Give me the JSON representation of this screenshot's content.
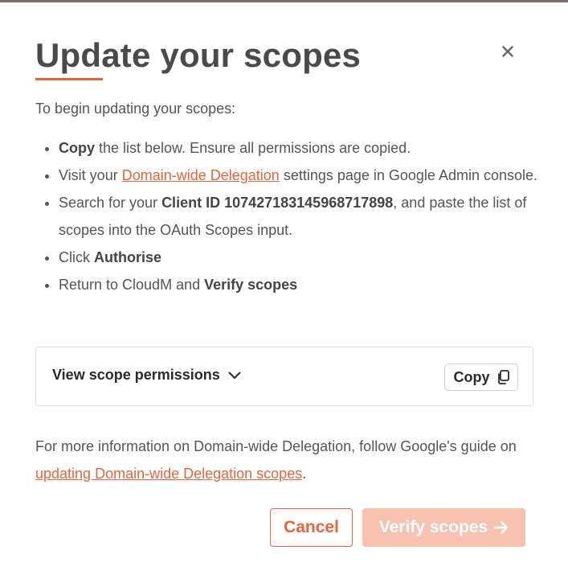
{
  "dialog": {
    "title": "Update your scopes",
    "intro": "To begin updating your scopes:",
    "steps": {
      "copy": {
        "bold": "Copy",
        "text": " the list below. Ensure all permissions are copied."
      },
      "visit": {
        "prefix": "Visit your ",
        "link": "Domain-wide Delegation",
        "suffix": " settings page in Google Admin console."
      },
      "search": {
        "prefix": "Search for your ",
        "bold": "Client ID 107427183145968717898",
        "suffix": ", and paste the list of scopes into the OAuth Scopes input."
      },
      "click": {
        "prefix": "Click ",
        "bold": "Authorise"
      },
      "return": {
        "prefix": "Return to CloudM and ",
        "bold": "Verify scopes"
      }
    },
    "permissions_panel": {
      "toggle_label": "View scope permissions",
      "copy_label": "Copy"
    },
    "more_info": {
      "prefix": "For more information on Domain-wide Delegation, follow Google's guide on ",
      "link": "updating Domain-wide Delegation scopes",
      "suffix": "."
    },
    "buttons": {
      "cancel": "Cancel",
      "verify": "Verify scopes"
    }
  },
  "icons": {
    "close": "close-icon",
    "chevron": "chevron-down-icon",
    "copy": "copy-icon",
    "arrow": "arrow-right-icon"
  },
  "colors": {
    "accent": "#e8643c",
    "accent_disabled": "#f8c2b1",
    "text": "#555555",
    "heading": "#4a4a4a"
  }
}
